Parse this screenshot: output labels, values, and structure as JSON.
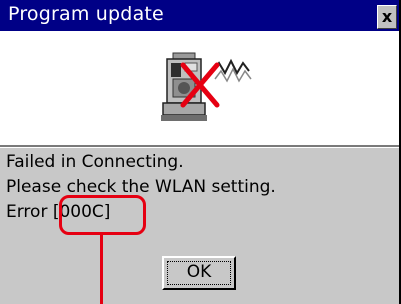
{
  "window": {
    "title": "Program update",
    "close_label": "x"
  },
  "icon": {
    "name": "instrument-error-icon"
  },
  "message": {
    "line1": "Failed in Connecting.",
    "line2": "Please check the WLAN setting.",
    "line3_prefix": "Error",
    "error_code": "[000C]"
  },
  "buttons": {
    "ok_label": "OK"
  },
  "colors": {
    "titlebar": "#000086",
    "panel": "#c8c8c8",
    "callout": "#e60012"
  }
}
